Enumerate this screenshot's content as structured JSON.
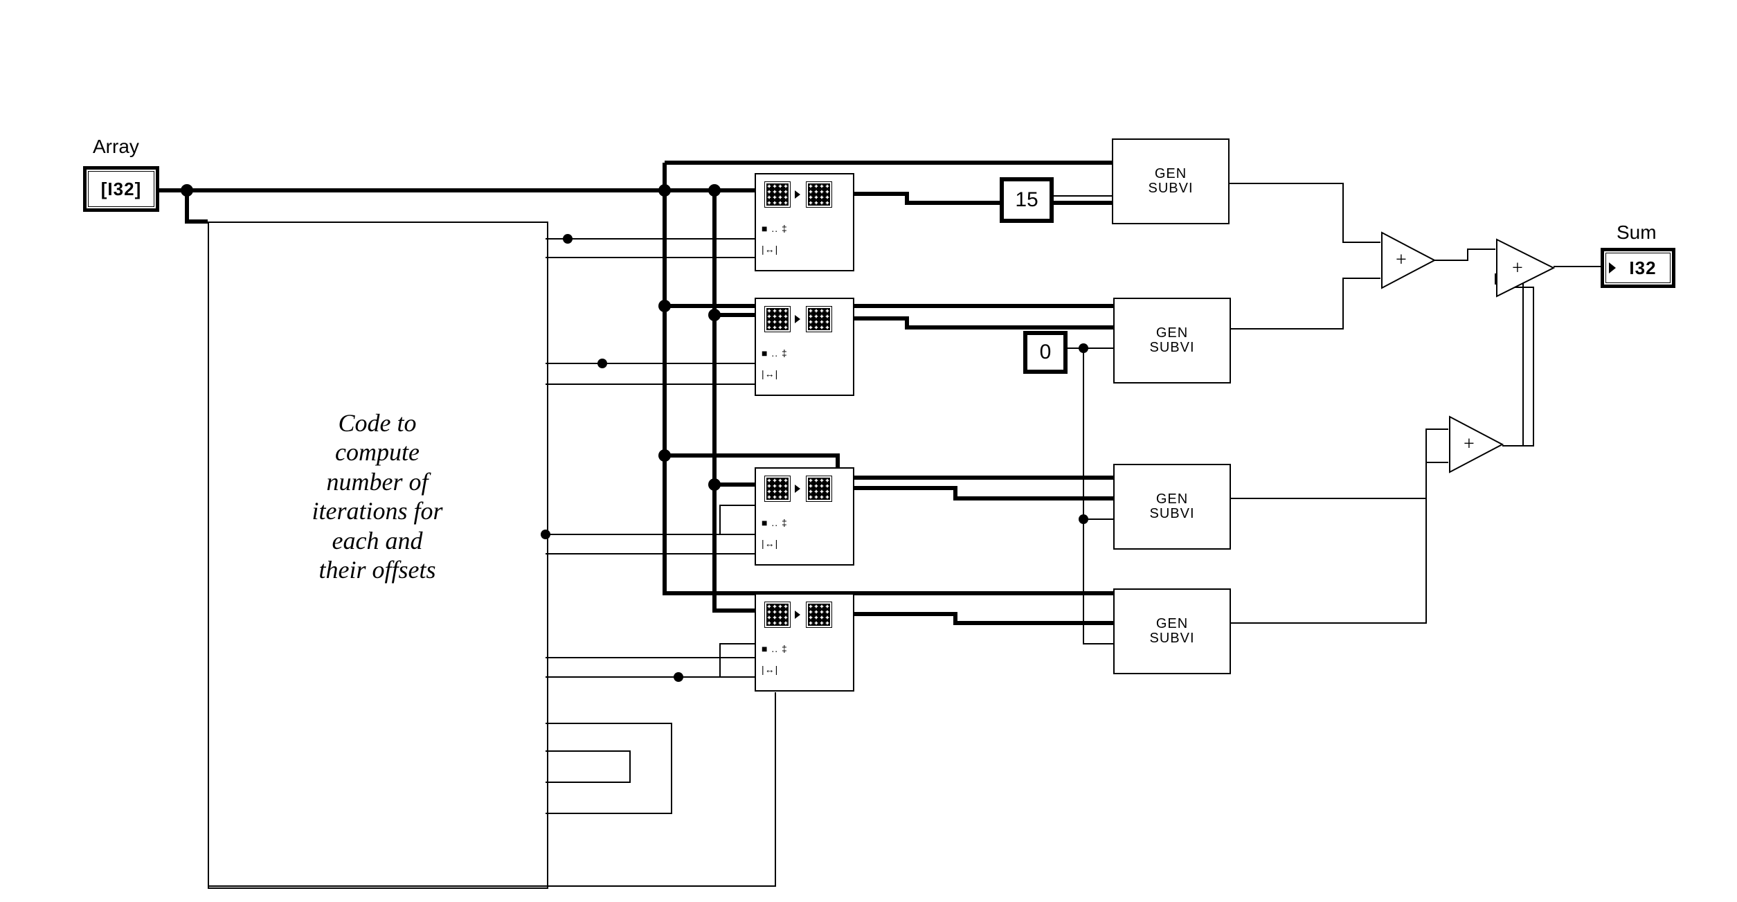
{
  "terminals": {
    "array": {
      "label": "Array",
      "type": "I32",
      "bracketed": "[I32]"
    },
    "sum": {
      "label": "Sum",
      "type": "I32"
    }
  },
  "constants": {
    "fifteen": 15,
    "zero": 0
  },
  "subvi_label": {
    "line1": "GEN",
    "line2": "SUBVI"
  },
  "decimate_glyphs": {
    "range": "■ .. ‡",
    "len": "|↔|"
  },
  "comment_lines": [
    "Code to",
    "compute",
    "number of",
    "iterations for",
    "each and",
    "their offsets"
  ],
  "add_symbol": "+"
}
